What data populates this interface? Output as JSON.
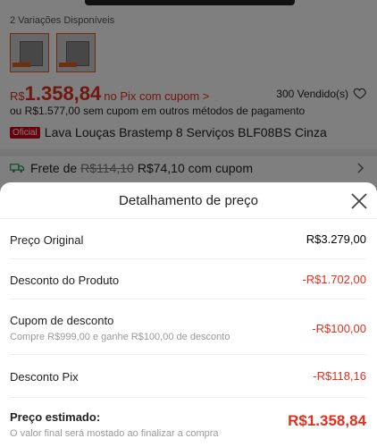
{
  "product": {
    "variations_label": "2 Variações Disponíveis",
    "price_currency": "R$",
    "price_value": "1.358,84",
    "price_note": "no Pix com cupom >",
    "sold": "300 Vendido(s)",
    "alt_price": "ou R$1.577,00 sem cupom em outros métodos de pagamento",
    "official_badge": "Oficial",
    "name": "Lava Louças Brastemp 8 Serviços BLF08BS Cinza"
  },
  "shipping": {
    "label": "Frete de",
    "original": "R$114,10",
    "discounted": "R$74,10 com cupom"
  },
  "sheet": {
    "title": "Detalhamento de preço",
    "rows": [
      {
        "label": "Preço Original",
        "value": "R$3.279,00"
      },
      {
        "label": "Desconto do Produto",
        "value": "-R$1.702,00"
      },
      {
        "label": "Cupom de desconto",
        "sub": "Compre R$999,00 e ganhe R$100,00 de desconto",
        "value": "-R$100,00"
      },
      {
        "label": "Desconto Pix",
        "value": "-R$118,16"
      }
    ],
    "total": {
      "label": "Preço estimado:",
      "sub": "O valor final será mostado ao finalizar a compra",
      "value": "R$1.358,84"
    }
  },
  "colors": {
    "accent": "#e0301e",
    "official": "#d0021b",
    "overlay": "rgba(0,0,0,0.5)"
  },
  "icons": [
    "heart-icon",
    "truck-icon",
    "chevron-right-icon",
    "close-icon"
  ]
}
